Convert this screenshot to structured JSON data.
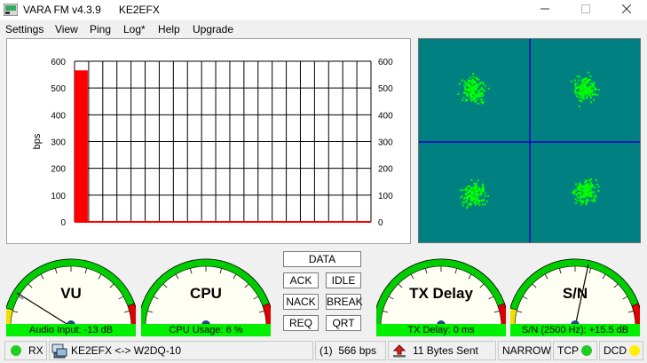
{
  "window": {
    "title": "VARA FM v4.3.9",
    "callsign": "KE2EFX",
    "buttons": [
      "minimize",
      "maximize",
      "close"
    ]
  },
  "menu": [
    "Settings",
    "View",
    "Ping",
    "Log*",
    "Help",
    "Upgrade"
  ],
  "chart_data": {
    "type": "bar",
    "ylabel": "bps",
    "ylim": [
      0,
      600
    ],
    "y_ticks": [
      "600",
      "500",
      "400",
      "300",
      "200",
      "100",
      "0"
    ],
    "values": [
      566,
      0,
      0,
      0,
      0,
      0,
      0,
      0,
      0,
      0,
      0,
      0,
      0,
      0,
      0,
      0,
      0,
      0,
      0,
      0,
      0
    ],
    "bar_color": "#ff0000",
    "grid": true
  },
  "constellation": {
    "background": "#008080",
    "point_color": "#00ff00",
    "axis_color": "#0000c0"
  },
  "meters": {
    "vu": {
      "title": "VU",
      "readout": "Audio Input: -13 dB"
    },
    "cpu": {
      "title": "CPU",
      "readout": "CPU Usage: 6 %"
    },
    "txdelay": {
      "title": "TX Delay",
      "readout": "TX Delay: 0 ms"
    },
    "sn": {
      "title": "S/N",
      "readout": "S/N (2500 Hz): +15.5 dB"
    }
  },
  "buttons": {
    "data": "DATA",
    "ack": "ACK",
    "idle": "IDLE",
    "nack": "NACK",
    "break": "BREAK",
    "req": "REQ",
    "qrt": "QRT"
  },
  "status": {
    "rx": "RX",
    "link": "KE2EFX <-> W2DQ-10",
    "speed": "(1)  566 bps",
    "sent": "11 Bytes Sent",
    "bandwidth": "NARROW",
    "tcp": "TCP",
    "dcd": "DCD",
    "colors": {
      "rx_led": "#22cc22",
      "tcp_led": "#22cc22",
      "dcd_led": "#ffee00"
    }
  }
}
